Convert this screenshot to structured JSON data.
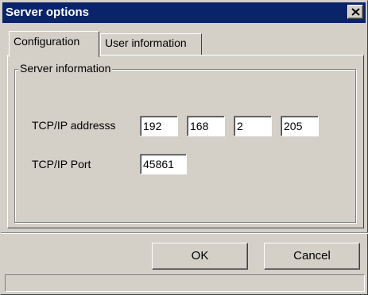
{
  "window": {
    "title": "Server options"
  },
  "tabs": [
    {
      "label": "Configuration",
      "active": true
    },
    {
      "label": "User information",
      "active": false
    }
  ],
  "group": {
    "label": "Server information"
  },
  "tcpip": {
    "label": "TCP/IP addresss",
    "octets": [
      "192",
      "168",
      "2",
      "205"
    ]
  },
  "port": {
    "label": "TCP/IP Port",
    "value": "45861"
  },
  "buttons": {
    "ok": "OK",
    "cancel": "Cancel"
  },
  "colors": {
    "titlebar": "#0a246a",
    "face": "#d4d0c8"
  },
  "icons": {
    "close": "close-icon"
  }
}
